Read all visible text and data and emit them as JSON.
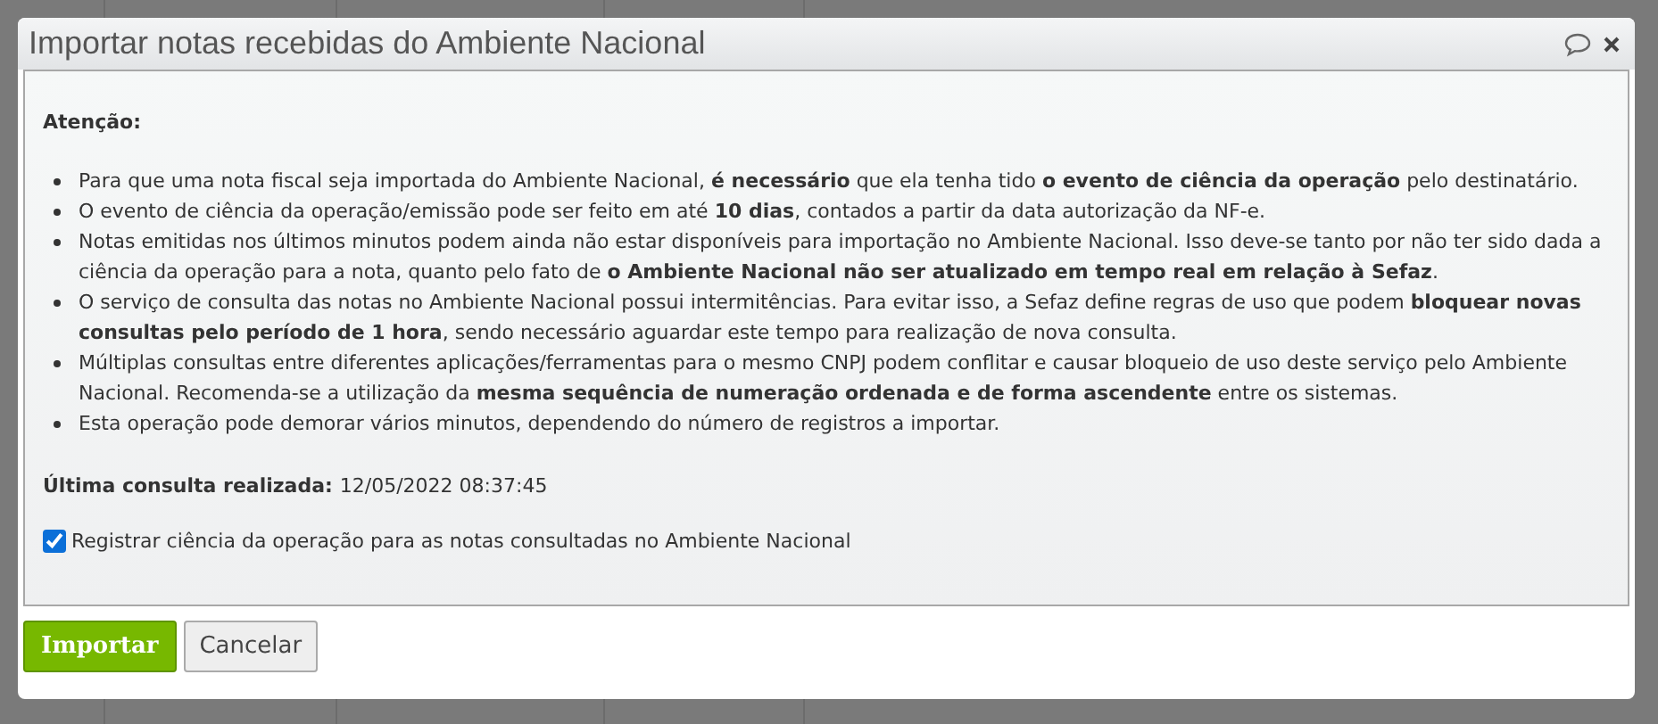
{
  "dialog": {
    "title": "Importar notas recebidas do Ambiente Nacional",
    "heading": "Atenção:",
    "notes": [
      "Para que uma nota fiscal seja importada do Ambiente Nacional, **é necessário** que ela tenha tido **o evento de ciência da operação** pelo destinatário.",
      "O evento de ciência da operação/emissão pode ser feito em até **10 dias**, contados a partir da data autorização da NF-e.",
      "Notas emitidas nos últimos minutos podem ainda não estar disponíveis para importação no Ambiente Nacional. Isso deve-se tanto por não ter sido dada a ciência da operação para a nota, quanto pelo fato de **o Ambiente Nacional não ser atualizado em tempo real em relação à Sefaz**.",
      "O serviço de consulta das notas no Ambiente Nacional possui intermitências. Para evitar isso, a Sefaz define regras de uso que podem **bloquear novas consultas pelo período de 1 hora**, sendo necessário aguardar este tempo para realização de nova consulta.",
      "Múltiplas consultas entre diferentes aplicações/ferramentas para o mesmo CNPJ podem conflitar e causar bloqueio de uso deste serviço pelo Ambiente Nacional. Recomenda-se a utilização da **mesma sequência de numeração ordenada e de forma ascendente** entre os sistemas.",
      "Esta operação pode demorar vários minutos, dependendo do número de registros a importar."
    ],
    "last_query": {
      "label": "Última consulta realizada:",
      "value": "12/05/2022 08:37:45"
    },
    "register_option": {
      "label": "Registrar ciência da operação para as notas consultadas no Ambiente Nacional",
      "checked": true
    },
    "buttons": [
      {
        "label": "Importar",
        "kind": "primary"
      },
      {
        "label": "Cancelar",
        "kind": "secondary"
      }
    ]
  }
}
